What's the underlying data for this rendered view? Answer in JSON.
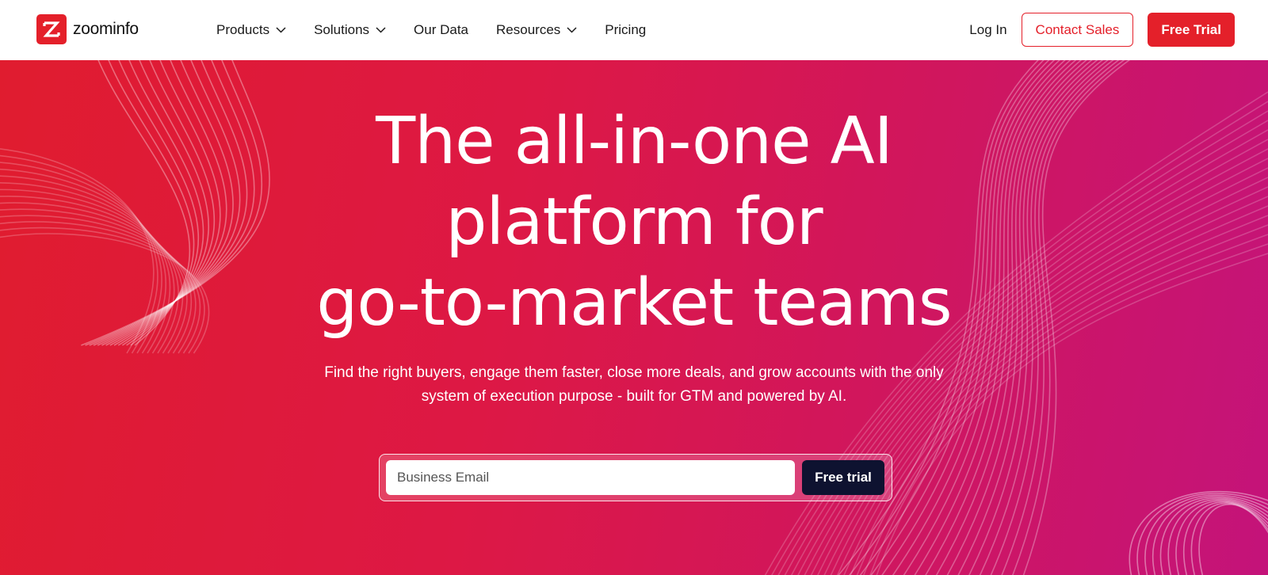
{
  "brand": {
    "name": "zoominfo",
    "color": "#e4202a"
  },
  "nav": {
    "items": [
      {
        "label": "Products",
        "has_dropdown": true
      },
      {
        "label": "Solutions",
        "has_dropdown": true
      },
      {
        "label": "Our Data",
        "has_dropdown": false
      },
      {
        "label": "Resources",
        "has_dropdown": true
      },
      {
        "label": "Pricing",
        "has_dropdown": false
      }
    ],
    "login_label": "Log In",
    "contact_label": "Contact Sales",
    "trial_label": "Free Trial"
  },
  "hero": {
    "title_lines": [
      "The all-in-one AI",
      "platform for",
      "go-to-market teams"
    ],
    "subtitle_lines": [
      "Find the right buyers, engage them faster, close more deals, and grow accounts with the only",
      "system of execution purpose - built for GTM and powered by AI."
    ],
    "email_placeholder": "Business Email",
    "cta_label": "Free trial",
    "gradient_colors": [
      "#e01c2f",
      "#c4137a"
    ],
    "cta_color": "#0e1230"
  }
}
